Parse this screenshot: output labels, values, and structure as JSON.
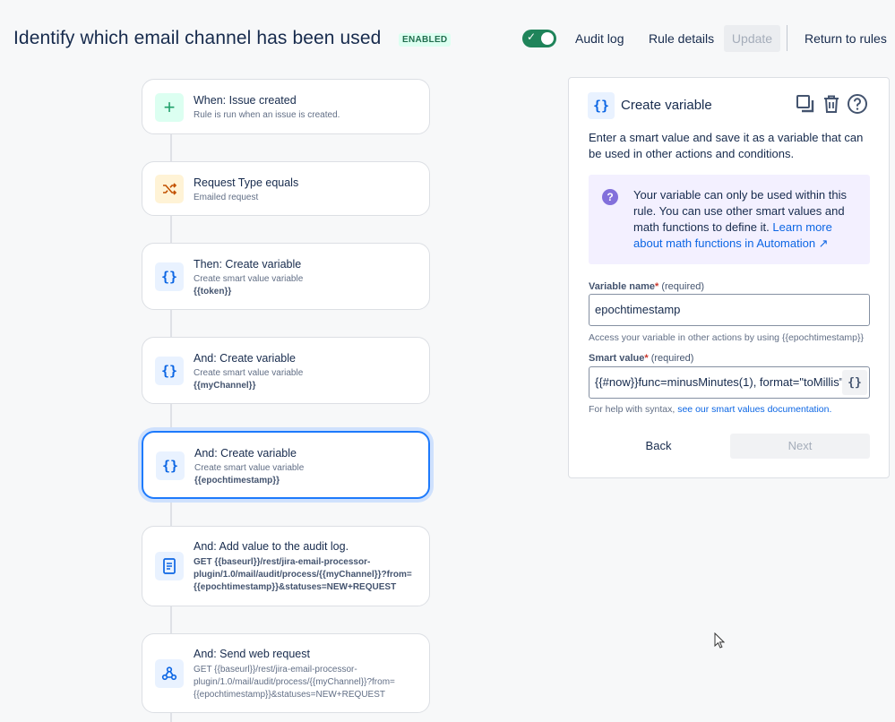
{
  "header": {
    "title": "Identify which email channel has been used",
    "badge": "ENABLED",
    "audit_log": "Audit log",
    "rule_details": "Rule details",
    "update": "Update",
    "return_to_rules": "Return to rules"
  },
  "flow": [
    {
      "title": "When: Issue created",
      "subtitle": "Rule is run when an issue is created.",
      "icon": "plus-icon"
    },
    {
      "title": "Request Type equals",
      "subtitle": "Emailed request",
      "icon": "shuffle-icon"
    },
    {
      "title": "Then: Create variable",
      "subtitle": "Create smart value variable",
      "value": "{{token}}",
      "icon": "braces-icon"
    },
    {
      "title": "And: Create variable",
      "subtitle": "Create smart value variable",
      "value": "{{myChannel}}",
      "icon": "braces-icon"
    },
    {
      "title": "And: Create variable",
      "subtitle": "Create smart value variable",
      "value": "{{epochtimestamp}}",
      "icon": "braces-icon"
    },
    {
      "title": "And: Add value to the audit log.",
      "lines": [
        "GET {{baseurl}}/rest/jira-email-processor-",
        "plugin/1.0/mail/audit/process/{{myChannel}}?from=",
        "{{epochtimestamp}}&statuses=NEW+REQUEST"
      ],
      "icon": "document-icon"
    },
    {
      "title": "And: Send web request",
      "lines": [
        "GET {{baseurl}}/rest/jira-email-processor-",
        "plugin/1.0/mail/audit/process/{{myChannel}}?from=",
        "{{epochtimestamp}}&statuses=NEW+REQUEST"
      ],
      "icon": "webhook-icon"
    }
  ],
  "panel": {
    "title": "Create variable",
    "description": "Enter a smart value and save it as a variable that can be used in other actions and conditions.",
    "info_text": "Your variable can only be used within this rule. You can use other smart values and math functions to define it.",
    "info_link": "Learn more about math functions in Automation ↗",
    "variable_name_label": "Variable name",
    "required": "(required)",
    "variable_name_value": "epochtimestamp",
    "variable_hint": "Access your variable in other actions by using {{epochtimestamp}}",
    "smart_value_label": "Smart value",
    "smart_value": "{{#now}}func=minusMinutes(1), format=\"toMillis\"",
    "syntax_hint": "For help with syntax,",
    "syntax_link": "see our smart values documentation.",
    "back": "Back",
    "next": "Next"
  },
  "colors": {
    "accent": "#0c66e4",
    "toggle_on": "#1f845a",
    "selected_border": "#1d7afc"
  }
}
